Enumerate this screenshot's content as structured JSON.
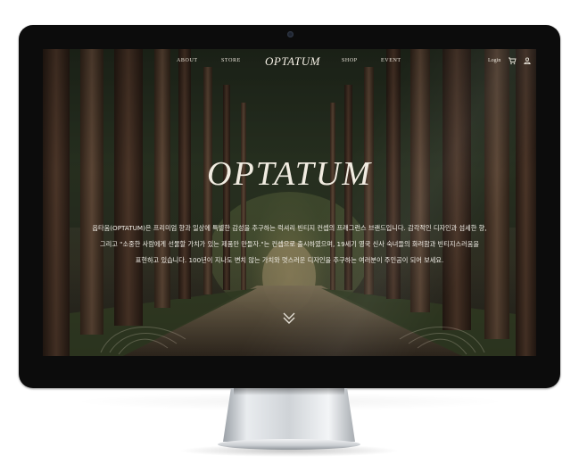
{
  "nav": {
    "links_left": [
      "ABOUT",
      "STORE"
    ],
    "logo": "OPTATUM",
    "links_right": [
      "SHOP",
      "EVENT"
    ],
    "login": "Login",
    "icons": [
      "cart-icon",
      "user-icon"
    ]
  },
  "hero": {
    "title": "OPTATUM",
    "description": [
      "옵타움(OPTATUM)은 프리미엄 향과 일상에 특별한 감성을 추구하는 럭셔리 빈티지 컨셉의 프래그런스 브랜드입니다. 감각적인 디자인과 섬세한 향,",
      "그리고 \"소중한 사람에게 선물할 가치가 있는 제품만 만들자.\"는 컨셉으로 출시하였으며, 19세기 영국 신사 숙녀들의 화려함과 빈티지스러움을",
      "표현하고 있습니다.  100년이 지나도 변치 않는 가치와 멋스러운 디자인을 추구하는 여러분이 주인공이 되어 보세요."
    ],
    "scroll_icon": "double-chevron-down-icon"
  },
  "colors": {
    "bezel": "#0c0c0c",
    "text": "#f1ece1",
    "stand": "#cfd3d7"
  }
}
